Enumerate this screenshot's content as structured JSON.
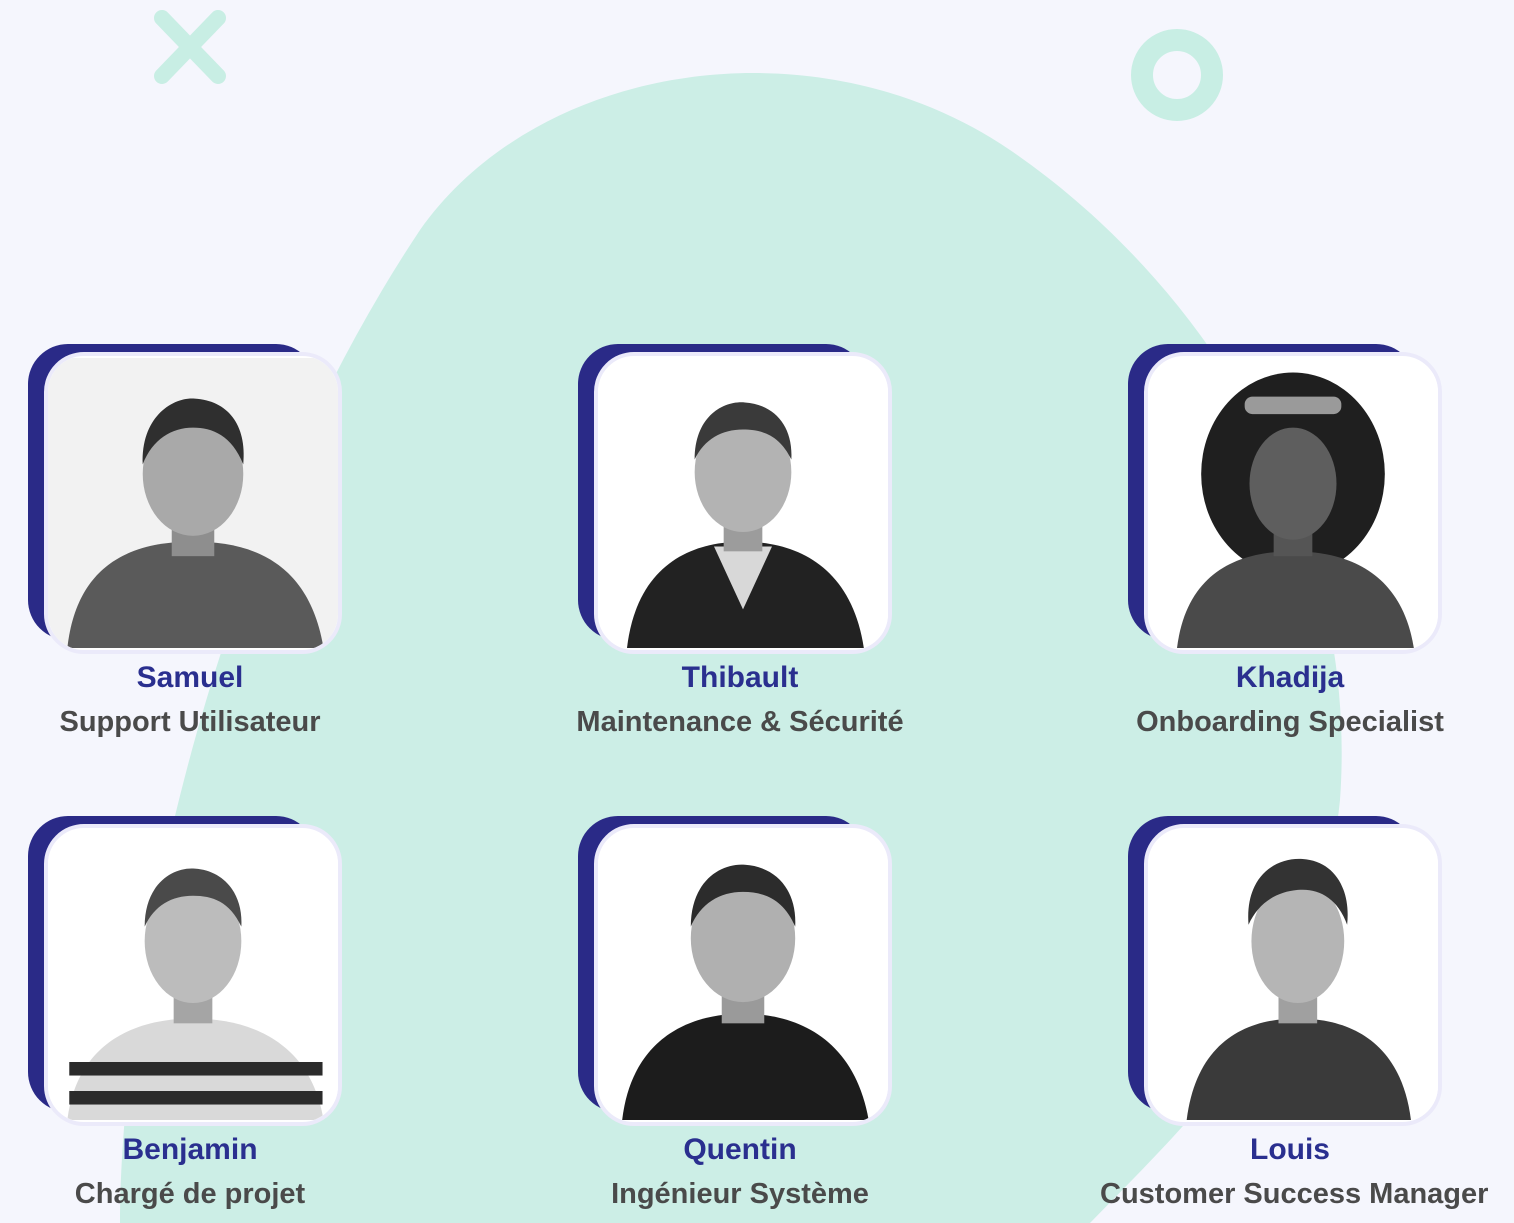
{
  "colors": {
    "background": "#f5f6fd",
    "blob": "#cceee6",
    "decoration": "#c8eee4",
    "frame_accent": "#2a2a87",
    "name_text": "#2a2f8f",
    "role_text": "#4a4a4a"
  },
  "decorations": [
    "x-mark-icon",
    "ring-icon"
  ],
  "team": [
    {
      "name": "Samuel",
      "role": "Support Utilisateur"
    },
    {
      "name": "Thibault",
      "role": "Maintenance & Sécurité"
    },
    {
      "name": "Khadija",
      "role": "Onboarding Specialist"
    },
    {
      "name": "Benjamin",
      "role": "Chargé de projet"
    },
    {
      "name": "Quentin",
      "role": "Ingénieur Système"
    },
    {
      "name": "Louis",
      "role": "Customer Success Manager"
    }
  ]
}
